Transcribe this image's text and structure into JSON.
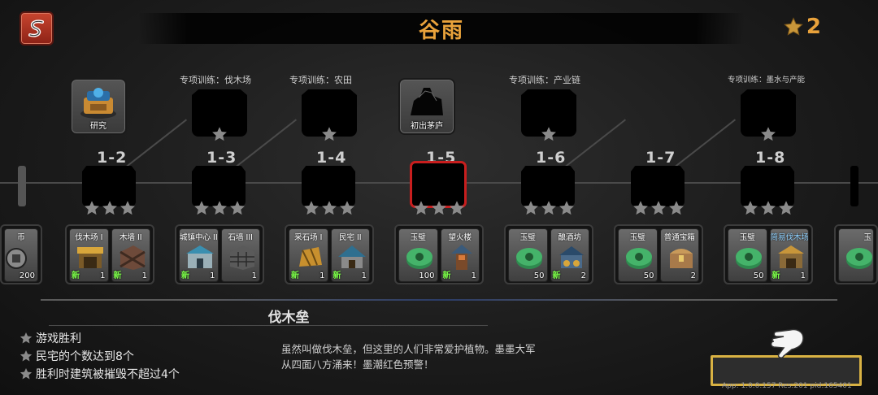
{
  "header": {
    "title": "谷雨",
    "star_total": "2"
  },
  "stages": [
    {
      "id": "1-2"
    },
    {
      "id": "1-3"
    },
    {
      "id": "1-4"
    },
    {
      "id": "1-5"
    },
    {
      "id": "1-6"
    },
    {
      "id": "1-7"
    },
    {
      "id": "1-8"
    }
  ],
  "top_nodes": [
    {
      "label": "研究"
    },
    {
      "label": "专项训练：伐木场"
    },
    {
      "label": "专项训练：农田"
    },
    {
      "label": "初出茅庐"
    },
    {
      "label": "专项训练：产业链"
    },
    {
      "label": "专项训练：墨水与产能"
    }
  ],
  "rewards": {
    "edge_left": {
      "name": "币",
      "qty": "200"
    },
    "edge_right": {
      "name": "玉"
    },
    "groups": [
      [
        {
          "name": "伐木场 I",
          "qty": "1",
          "new": "新"
        },
        {
          "name": "木墙 II",
          "qty": "1",
          "new": "新"
        }
      ],
      [
        {
          "name": "城镇中心 II",
          "qty": "1",
          "new": "新"
        },
        {
          "name": "石墙 III",
          "qty": "1",
          "new": ""
        }
      ],
      [
        {
          "name": "采石场 I",
          "qty": "1",
          "new": "新"
        },
        {
          "name": "民宅 II",
          "qty": "1",
          "new": "新"
        }
      ],
      [
        {
          "name": "玉璧",
          "qty": "100",
          "new": ""
        },
        {
          "name": "望火楼",
          "qty": "1",
          "new": "新"
        }
      ],
      [
        {
          "name": "玉璧",
          "qty": "50",
          "new": ""
        },
        {
          "name": "酿酒坊",
          "qty": "2",
          "new": "新"
        }
      ],
      [
        {
          "name": "玉璧",
          "qty": "50",
          "new": ""
        },
        {
          "name": "普通宝箱",
          "qty": "2",
          "new": ""
        }
      ],
      [
        {
          "name": "玉璧",
          "qty": "50",
          "new": ""
        },
        {
          "name": "简易伐木场",
          "qty": "1",
          "new": "新"
        }
      ]
    ]
  },
  "level": {
    "name": "伐木垒",
    "objectives": [
      "游戏胜利",
      "民宅的个数达到8个",
      "胜利时建筑被摧毁不超过4个"
    ],
    "description_line1": "虽然叫做伐木垒，但这里的人们非常爱护植物。墨墨大军",
    "description_line2": "从四面八方涌来！墨潮红色预警！"
  },
  "footer": {
    "version": "App: 1.0.0.157 Res:201 pid:165401"
  },
  "colors": {
    "accent": "#e9a23b",
    "selected": "#c81e1e",
    "start_border": "#d9b243",
    "star_gray": "#8a8a8a"
  }
}
